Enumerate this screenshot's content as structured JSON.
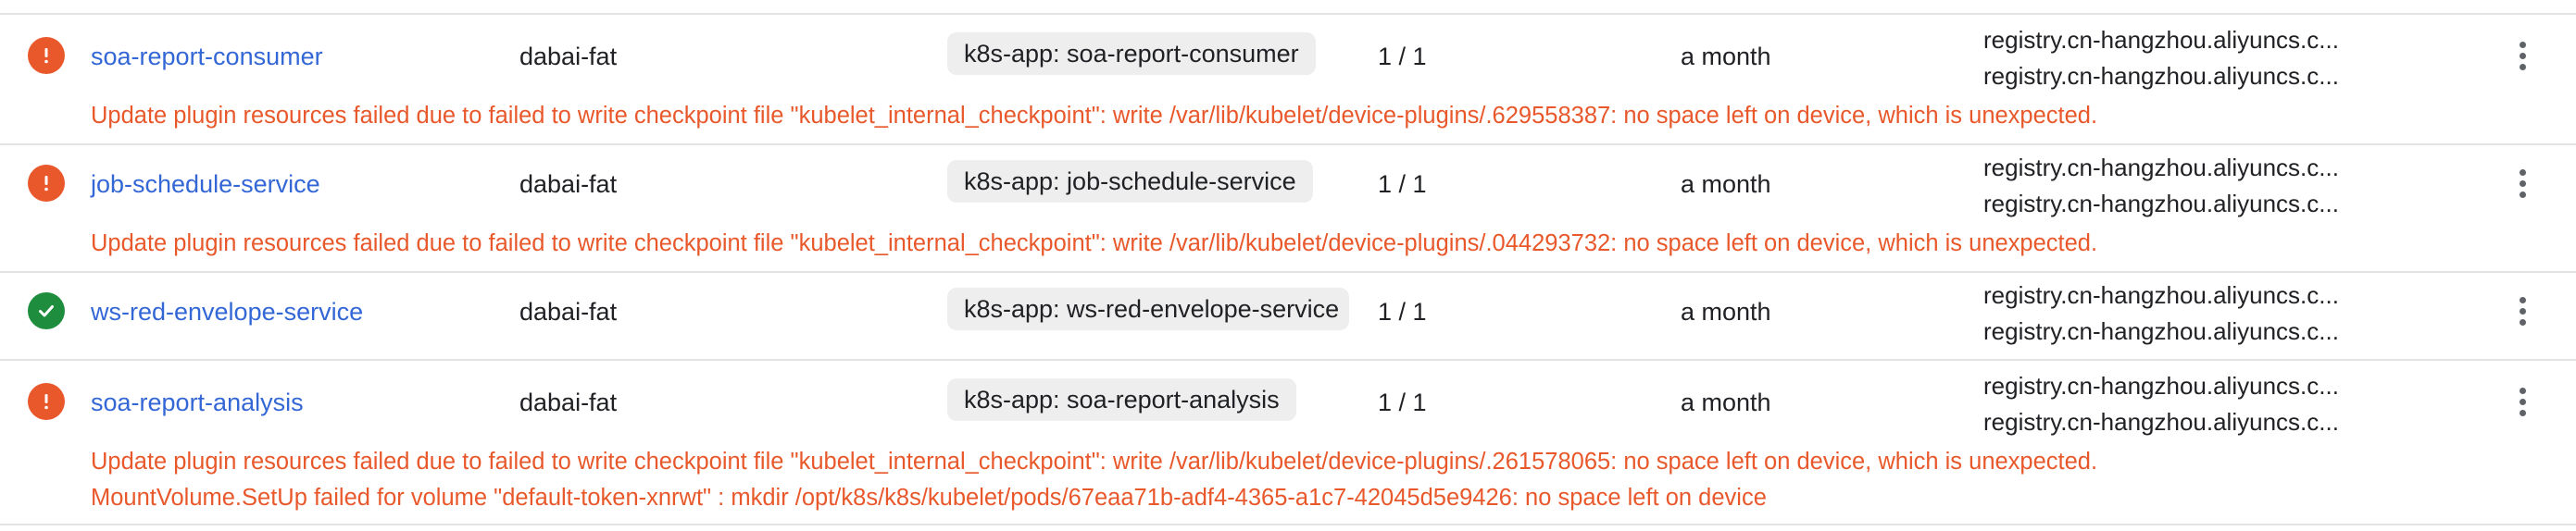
{
  "colors": {
    "link": "#3367d6",
    "error": "#e8582b",
    "ok": "#1e8e3e",
    "chip_bg": "#eeeeee"
  },
  "workloads": [
    {
      "status": "error",
      "status_icon": "exclamation-icon",
      "name": "soa-report-consumer",
      "namespace": "dabai-fat",
      "label": "k8s-app: soa-report-consumer",
      "pods": "1 / 1",
      "age": "a month",
      "images": [
        "registry.cn-hangzhou.aliyuncs.c...",
        "registry.cn-hangzhou.aliyuncs.c..."
      ],
      "messages": [
        "Update plugin resources failed due to failed to write checkpoint file \"kubelet_internal_checkpoint\": write /var/lib/kubelet/device-plugins/.629558387: no space left on device, which is unexpected."
      ]
    },
    {
      "status": "error",
      "status_icon": "exclamation-icon",
      "name": "job-schedule-service",
      "namespace": "dabai-fat",
      "label": "k8s-app: job-schedule-service",
      "pods": "1 / 1",
      "age": "a month",
      "images": [
        "registry.cn-hangzhou.aliyuncs.c...",
        "registry.cn-hangzhou.aliyuncs.c..."
      ],
      "messages": [
        "Update plugin resources failed due to failed to write checkpoint file \"kubelet_internal_checkpoint\": write /var/lib/kubelet/device-plugins/.044293732: no space left on device, which is unexpected."
      ]
    },
    {
      "status": "ok",
      "status_icon": "checkmark-icon",
      "name": "ws-red-envelope-service",
      "namespace": "dabai-fat",
      "label": "k8s-app: ws-red-envelope-service",
      "pods": "1 / 1",
      "age": "a month",
      "images": [
        "registry.cn-hangzhou.aliyuncs.c...",
        "registry.cn-hangzhou.aliyuncs.c..."
      ],
      "messages": []
    },
    {
      "status": "error",
      "status_icon": "exclamation-icon",
      "name": "soa-report-analysis",
      "namespace": "dabai-fat",
      "label": "k8s-app: soa-report-analysis",
      "pods": "1 / 1",
      "age": "a month",
      "images": [
        "registry.cn-hangzhou.aliyuncs.c...",
        "registry.cn-hangzhou.aliyuncs.c..."
      ],
      "messages": [
        "Update plugin resources failed due to failed to write checkpoint file \"kubelet_internal_checkpoint\": write /var/lib/kubelet/device-plugins/.261578065: no space left on device, which is unexpected.",
        "MountVolume.SetUp failed for volume \"default-token-xnrwt\" : mkdir /opt/k8s/k8s/kubelet/pods/67eaa71b-adf4-4365-a1c7-42045d5e9426: no space left on device"
      ]
    }
  ]
}
